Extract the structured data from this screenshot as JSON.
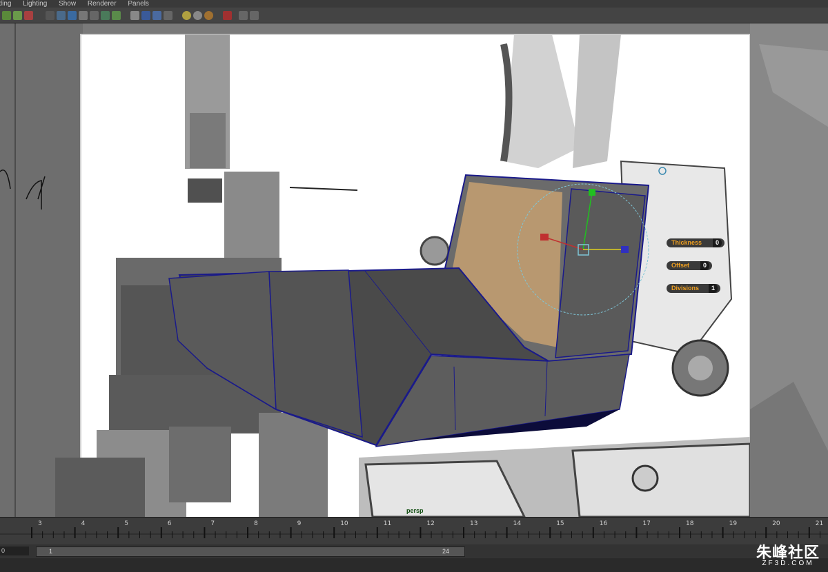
{
  "menu": [
    "ading",
    "Lighting",
    "Show",
    "Renderer",
    "Panels"
  ],
  "toolbar_icons": [
    "select-icon",
    "lasso-icon",
    "paint-icon",
    "grid-icon",
    "film-icon",
    "camera-icon",
    "xray-icon",
    "uv-icon",
    "texture-icon",
    "wireframe-icon",
    "shaded-icon",
    "smooth-icon",
    "checker-icon",
    "light-icon",
    "shadow-icon",
    "ao-icon",
    "isolate-icon",
    "cube-icon",
    "multi-icon",
    "share-icon"
  ],
  "channel_box": [
    {
      "label": "Thickness",
      "value": "0"
    },
    {
      "label": "Offset",
      "value": "0"
    },
    {
      "label": "Divisions",
      "value": "1"
    }
  ],
  "viewport_label": "persp",
  "timeline_ticks": [
    "3",
    "4",
    "5",
    "6",
    "7",
    "8",
    "9",
    "10",
    "11",
    "12",
    "13",
    "14",
    "15",
    "16",
    "17",
    "18",
    "19",
    "20",
    "21"
  ],
  "range": {
    "start_field": "0",
    "start": "1",
    "end": "24"
  },
  "watermark": {
    "cn": "朱峰社区",
    "en": "ZF3D.COM"
  },
  "colors": {
    "accent": "#f0a020",
    "wire": "#1a1a8a",
    "selected_face": "#b89870"
  }
}
